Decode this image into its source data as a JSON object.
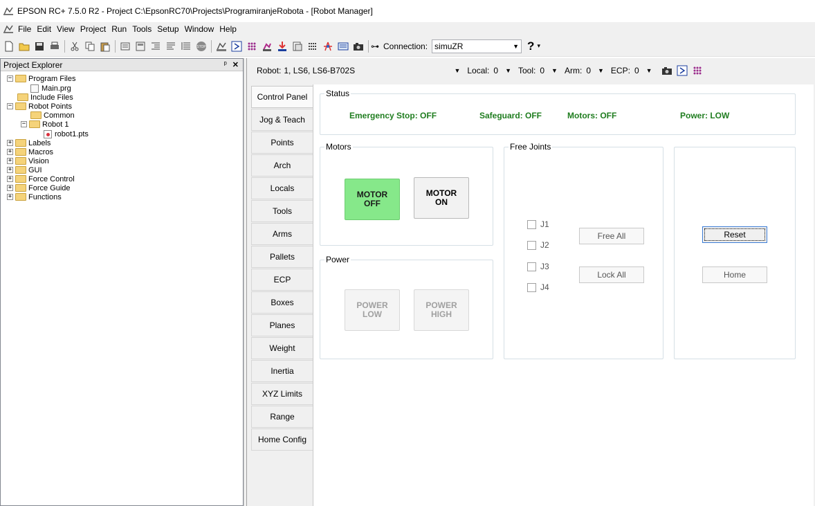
{
  "window": {
    "title": "EPSON RC+ 7.5.0 R2 - Project C:\\EpsonRC70\\Projects\\ProgramiranjeRobota - [Robot Manager]"
  },
  "menu": [
    "File",
    "Edit",
    "View",
    "Project",
    "Run",
    "Tools",
    "Setup",
    "Window",
    "Help"
  ],
  "toolbar": {
    "connection_label": "Connection:",
    "connection_value": "simuZR",
    "help": "?"
  },
  "project_explorer": {
    "title": "Project Explorer",
    "pin": "ℵ",
    "close": "✕",
    "tree": [
      {
        "label": "Program Files",
        "expander": "−",
        "icon": "folder-open"
      },
      {
        "label": "Main.prg",
        "icon": "file"
      },
      {
        "label": "Include Files",
        "icon": "folder"
      },
      {
        "label": "Robot Points",
        "expander": "−",
        "icon": "folder-open"
      },
      {
        "label": "Common",
        "icon": "folder"
      },
      {
        "label": "Robot 1",
        "expander": "−",
        "icon": "folder-open"
      },
      {
        "label": "robot1.pts",
        "icon": "points-file"
      },
      {
        "label": "Labels",
        "expander": "+",
        "icon": "folder"
      },
      {
        "label": "Macros",
        "expander": "+",
        "icon": "folder"
      },
      {
        "label": "Vision",
        "expander": "+",
        "icon": "folder"
      },
      {
        "label": "GUI",
        "expander": "+",
        "icon": "folder"
      },
      {
        "label": "Force Control",
        "expander": "+",
        "icon": "folder"
      },
      {
        "label": "Force Guide",
        "expander": "+",
        "icon": "folder"
      },
      {
        "label": "Functions",
        "expander": "+",
        "icon": "folder"
      }
    ]
  },
  "robot_manager": {
    "selectors": {
      "robot_label": "Robot:",
      "robot_value": "1, LS6, LS6-B702S",
      "local_label": "Local:",
      "local_value": "0",
      "tool_label": "Tool:",
      "tool_value": "0",
      "arm_label": "Arm:",
      "arm_value": "0",
      "ecp_label": "ECP:",
      "ecp_value": "0"
    },
    "tabs": [
      "Control Panel",
      "Jog & Teach",
      "Points",
      "Arch",
      "Locals",
      "Tools",
      "Arms",
      "Pallets",
      "ECP",
      "Boxes",
      "Planes",
      "Weight",
      "Inertia",
      "XYZ Limits",
      "Range",
      "Home Config"
    ],
    "active_tab": "Control Panel",
    "status": {
      "title": "Status",
      "emergency_stop": "Emergency Stop: OFF",
      "safeguard": "Safeguard: OFF",
      "motors": "Motors: OFF",
      "power": "Power: LOW",
      "color": "#1f7d1f"
    },
    "motors": {
      "title": "Motors",
      "off_line1": "MOTOR",
      "off_line2": "OFF",
      "on_line1": "MOTOR",
      "on_line2": "ON",
      "active_color": "#86e88a"
    },
    "power": {
      "title": "Power",
      "low_line1": "POWER",
      "low_line2": "LOW",
      "high_line1": "POWER",
      "high_line2": "HIGH"
    },
    "free_joints": {
      "title": "Free Joints",
      "joints": [
        "J1",
        "J2",
        "J3",
        "J4"
      ],
      "free_all": "Free All",
      "lock_all": "Lock All"
    },
    "actions": {
      "reset": "Reset",
      "home": "Home"
    }
  }
}
